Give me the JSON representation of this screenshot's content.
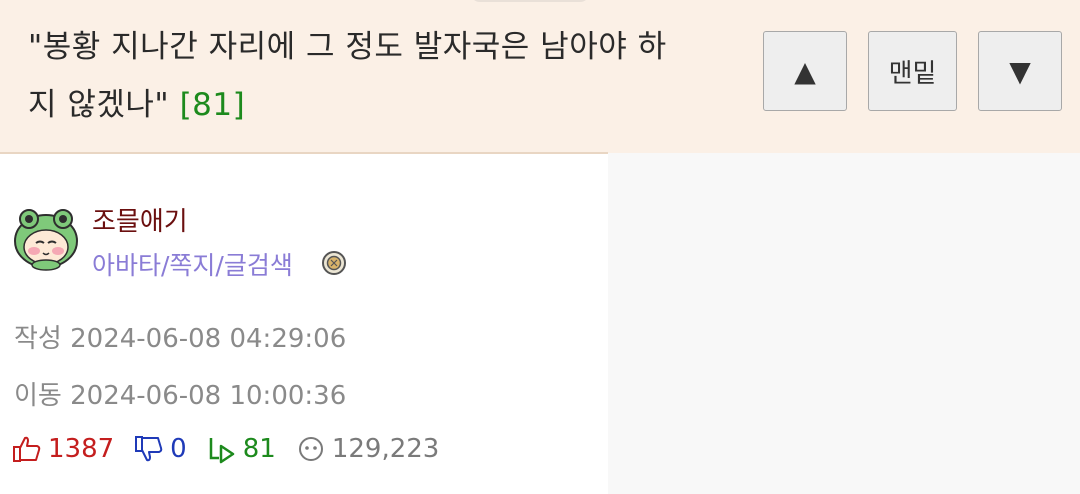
{
  "post": {
    "title_line1": "\"봉황 지나간 자리에 그 정도 발자국은 남아야 하",
    "title_line2": "지 않겠나\"",
    "reply_count_label": "[81]"
  },
  "nav": {
    "up_glyph": "▲",
    "bottom_label": "맨밑",
    "down_glyph": "▼"
  },
  "author": {
    "name": "조믈애기",
    "links": "아바타/쪽지/글검색",
    "avatar_icon": "frog-hood-character-icon",
    "badge_icon": "coin-badge-icon"
  },
  "meta": {
    "created": "작성 2024-06-08 04:29:06",
    "moved": "이동 2024-06-08 10:00:36"
  },
  "stats": {
    "upvotes": "1387",
    "downvotes": "0",
    "replies": "81",
    "views": "129,223"
  },
  "colors": {
    "header_bg": "#fbf0e6",
    "author_name": "#6b0f0f",
    "author_links": "#8a7cd6",
    "upvote": "#c41e1e",
    "downvote": "#1f3ab8",
    "reply": "#1d8a1d"
  }
}
